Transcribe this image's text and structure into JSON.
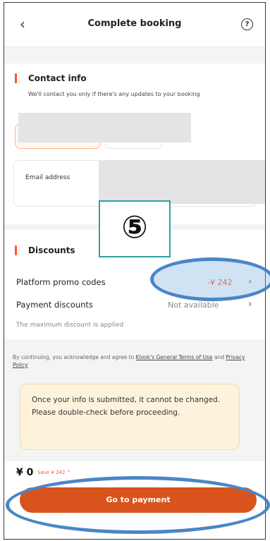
{
  "header": {
    "title": "Complete booking",
    "back_icon": "chevron-left-icon",
    "help_icon": "?"
  },
  "contact": {
    "title": "Contact info",
    "description": "We'll contact you only if there's any updates to your booking",
    "email_label": "Email address"
  },
  "discounts": {
    "title": "Discounts",
    "promo_label": "Platform promo codes",
    "promo_value": "-¥ 242",
    "payment_label": "Payment discounts",
    "payment_value": "Not available",
    "chevron": "›",
    "max_note": "The maximum discount is applied"
  },
  "terms": {
    "prefix": "By continuing, you acknowledge and agree to ",
    "link1": "Klook's General Terms of Use",
    "middle": " and ",
    "link2": "Privacy Policy"
  },
  "notice": {
    "text": "Once your info is submitted, it cannot be changed. Please double-check before proceeding."
  },
  "footer": {
    "price": "¥ 0",
    "save": "Save ¥ 242 ^",
    "pay_button": "Go to payment"
  },
  "annotation": {
    "step": "⑤"
  },
  "colors": {
    "accent": "#ff5722",
    "button": "#d9531c",
    "highlight": "#4a86c6",
    "step_border": "#2aa3a0"
  }
}
